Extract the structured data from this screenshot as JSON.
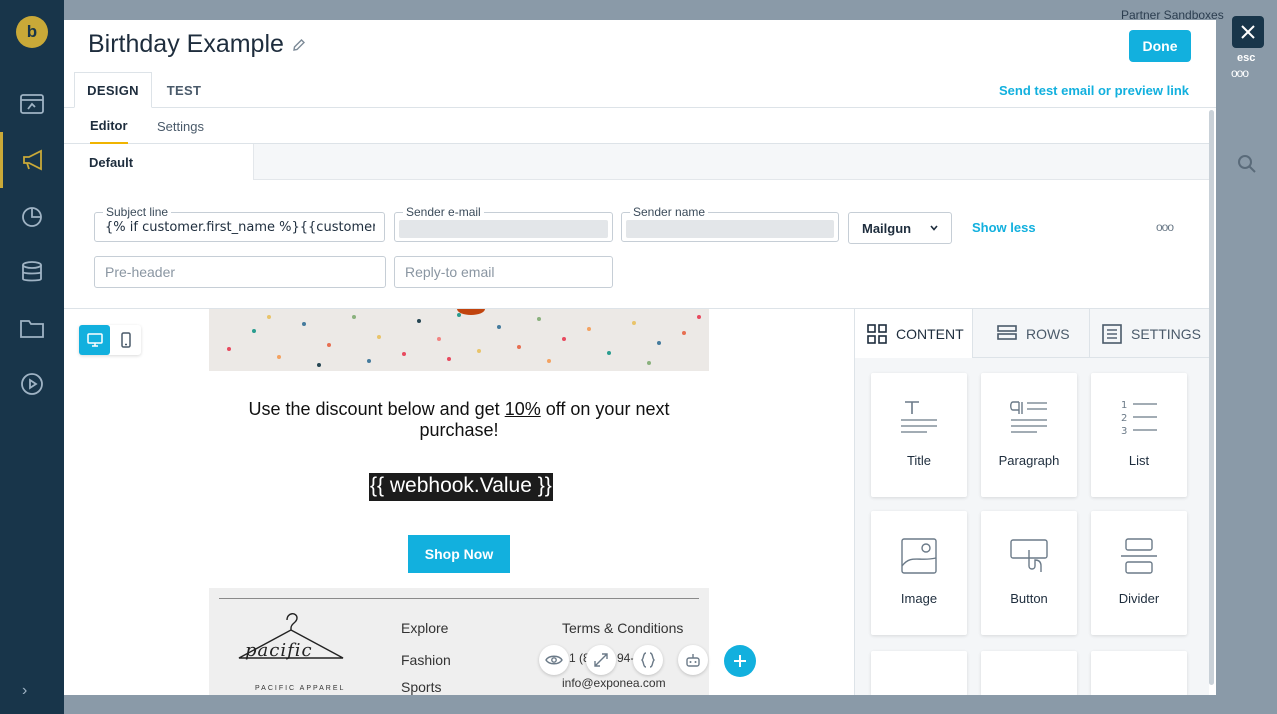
{
  "app": {
    "logo_letter": "b"
  },
  "background": {
    "partner_label": "Partner Sandboxes",
    "esc_label": "esc"
  },
  "header": {
    "title": "Birthday Example",
    "done_label": "Done"
  },
  "tabs": [
    {
      "label": "DESIGN"
    },
    {
      "label": "TEST"
    }
  ],
  "send_test_link": "Send test email or preview link",
  "subtabs": [
    {
      "label": "Editor"
    },
    {
      "label": "Settings"
    }
  ],
  "variant": {
    "label": "Default"
  },
  "fields": {
    "subject": {
      "label": "Subject line",
      "value": "{% if customer.first_name %}{{customer.f"
    },
    "sender_email": {
      "label": "Sender e-mail"
    },
    "sender_name": {
      "label": "Sender name"
    },
    "provider": {
      "value": "Mailgun"
    },
    "show_less": "Show less",
    "preheader": {
      "placeholder": "Pre-header"
    },
    "reply_to": {
      "placeholder": "Reply-to email"
    }
  },
  "email": {
    "promo_before": "Use the discount below and get ",
    "promo_discount": "10%",
    "promo_after": " off on your next purchase!",
    "webhook": "{{ webhook.Value }}",
    "shop_button": "Shop Now",
    "footer": {
      "brand": "pacific",
      "brand_sub": "PACIFIC APPAREL",
      "explore": "Explore",
      "links": [
        "Fashion",
        "Sports"
      ],
      "terms": "Terms & Conditions",
      "phone_partial": "1 (8",
      "phone_partial_end": "94-",
      "email": "info@exponea.com"
    }
  },
  "panel": {
    "tabs": [
      {
        "label": "CONTENT"
      },
      {
        "label": "ROWS"
      },
      {
        "label": "SETTINGS"
      }
    ],
    "tiles": [
      {
        "label": "Title"
      },
      {
        "label": "Paragraph"
      },
      {
        "label": "List"
      },
      {
        "label": "Image"
      },
      {
        "label": "Button"
      },
      {
        "label": "Divider"
      }
    ]
  },
  "colors": {
    "accent": "#12b0de",
    "sidebar": "#18354a",
    "highlight": "#f0b400"
  }
}
